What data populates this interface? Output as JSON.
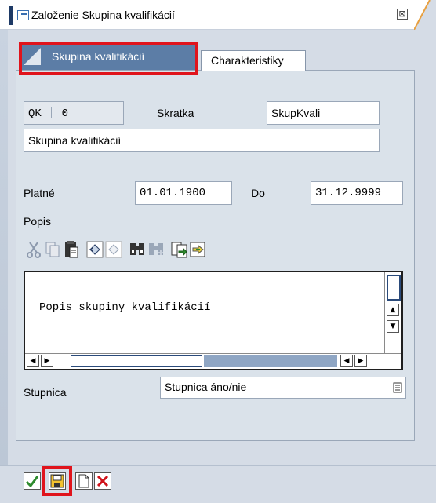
{
  "window": {
    "title": "Založenie Skupina kvalifikácií",
    "close_symbol": "⊠"
  },
  "tabs": [
    {
      "label": "Skupina kvalifikácií",
      "active": true
    },
    {
      "label": "Charakteristiky",
      "active": false
    }
  ],
  "form": {
    "object_type": "QK",
    "object_id": "0",
    "abbreviation_label": "Skratka",
    "abbreviation_value": "SkupKvali",
    "name_value": "Skupina kvalifikácií",
    "valid_from_label": "Platné",
    "valid_from_value": "01.01.1900",
    "valid_to_label": "Do",
    "valid_to_value": "31.12.9999",
    "description_label": "Popis",
    "description_text": "Popis skupiny kvalifikácií",
    "scale_label": "Stupnica",
    "scale_value": "Stupnica áno/nie"
  },
  "editor_toolbar": {
    "icons": [
      "cut-icon",
      "copy-icon",
      "paste-icon",
      "undo-icon",
      "redo-icon",
      "find-icon",
      "find-next-icon",
      "load-local-file-icon",
      "save-local-file-icon"
    ]
  },
  "bottom_bar": {
    "icons": [
      "check-icon",
      "save-icon",
      "new-icon",
      "cancel-icon"
    ]
  },
  "colors": {
    "active_tab": "#5c7da6",
    "highlight": "#e0141c",
    "panel": "#dae2ea"
  }
}
